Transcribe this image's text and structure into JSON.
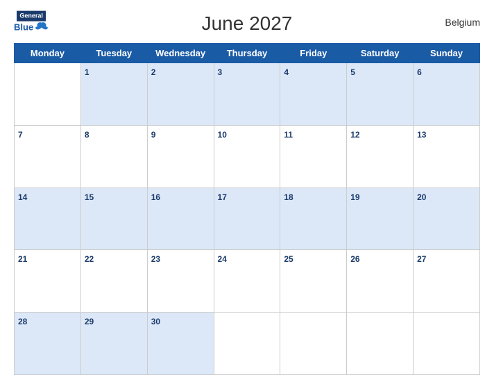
{
  "header": {
    "title": "June 2027",
    "country": "Belgium",
    "logo_line1": "General",
    "logo_line2": "Blue"
  },
  "weekdays": [
    "Monday",
    "Tuesday",
    "Wednesday",
    "Thursday",
    "Friday",
    "Saturday",
    "Sunday"
  ],
  "weeks": [
    [
      null,
      1,
      2,
      3,
      4,
      5,
      6
    ],
    [
      7,
      8,
      9,
      10,
      11,
      12,
      13
    ],
    [
      14,
      15,
      16,
      17,
      18,
      19,
      20
    ],
    [
      21,
      22,
      23,
      24,
      25,
      26,
      27
    ],
    [
      28,
      29,
      30,
      null,
      null,
      null,
      null
    ]
  ]
}
